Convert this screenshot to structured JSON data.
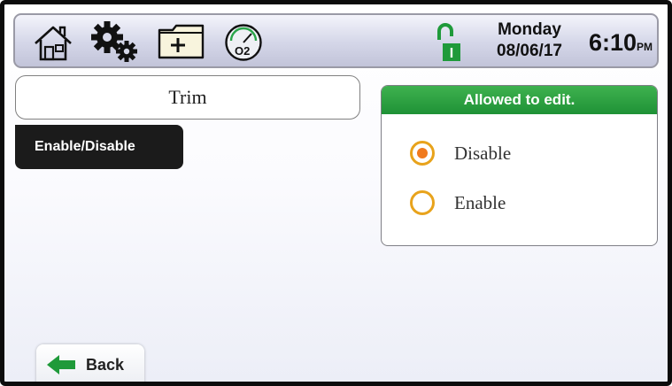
{
  "status_bar": {
    "icons": [
      "home-icon",
      "settings-icon",
      "new-folder-icon",
      "o2-gauge-icon",
      "lock-icon"
    ],
    "o2_label": "O2",
    "lock_letter": "I",
    "day": "Monday",
    "date": "08/06/17",
    "time": "6:10",
    "ampm": "PM"
  },
  "left": {
    "section_title": "Trim",
    "menu_button": "Enable/Disable"
  },
  "panel": {
    "header": "Allowed to edit.",
    "options": [
      {
        "label": "Disable",
        "selected": true
      },
      {
        "label": "Enable",
        "selected": false
      }
    ]
  },
  "footer": {
    "back_label": "Back"
  },
  "colors": {
    "header_green": "#2a9b3f",
    "radio_ring": "#e8a31c",
    "radio_dot": "#f07a1e",
    "button_dark": "#1b1b1b",
    "lock_green": "#1f9a3a"
  }
}
